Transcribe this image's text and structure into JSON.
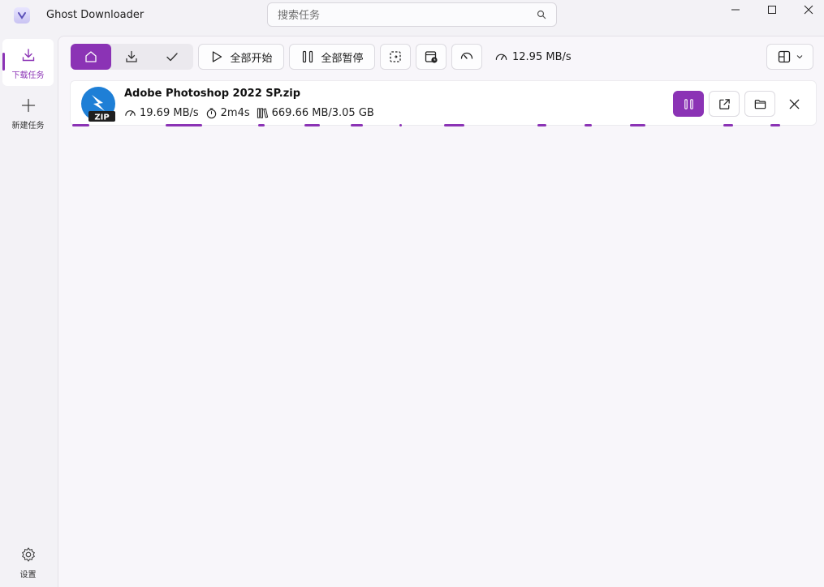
{
  "app": {
    "title": "Ghost Downloader"
  },
  "search": {
    "placeholder": "搜索任务"
  },
  "sidebar": {
    "items": [
      {
        "label": "下载任务",
        "icon": "download-icon",
        "active": true
      },
      {
        "label": "新建任务",
        "icon": "plus-icon",
        "active": false
      }
    ],
    "settings_label": "设置"
  },
  "toolbar": {
    "filters": [
      {
        "icon": "home-icon",
        "active": true
      },
      {
        "icon": "download-icon",
        "active": false
      },
      {
        "icon": "check-icon",
        "active": false
      }
    ],
    "start_all_label": "全部开始",
    "pause_all_label": "全部暂停",
    "total_speed": "12.95 MB/s",
    "accent": "#8b33b5"
  },
  "task": {
    "file_name": "Adobe Photoshop 2022 SP.zip",
    "file_type": "ZIP",
    "speed": "19.69 MB/s",
    "remaining": "2m4s",
    "size_progress": "669.66 MB/3.05 GB"
  }
}
